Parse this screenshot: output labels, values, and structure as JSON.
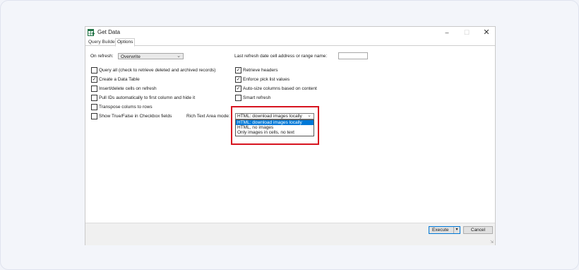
{
  "window": {
    "title": "Get Data"
  },
  "tabs": [
    {
      "label": "Query Builder"
    },
    {
      "label": "Options"
    }
  ],
  "on_refresh": {
    "label": "On refresh:",
    "value": "Overwrite"
  },
  "last_refresh": {
    "label": "Last refresh date cell address or range name:",
    "value": ""
  },
  "left_options": [
    {
      "label": "Query all (check to retrieve deleted and archived records)",
      "checked": false
    },
    {
      "label": "Create a Data Table",
      "checked": true
    },
    {
      "label": "Insert/delete cells on refresh",
      "checked": false
    },
    {
      "label": "Pull IDs automatically to first column and hide it",
      "checked": false
    },
    {
      "label": "Transpose colums to rows",
      "checked": false
    },
    {
      "label": "Show True/False in Checkbox fields",
      "checked": false
    }
  ],
  "right_options": [
    {
      "label": "Retrieve headers",
      "checked": true
    },
    {
      "label": "Enforce pick list values",
      "checked": true
    },
    {
      "label": "Auto-size columns based on content",
      "checked": true
    },
    {
      "label": "Smart refresh",
      "checked": false
    }
  ],
  "rich_text": {
    "label": "Rich Text Area mode:",
    "value": "HTML: download images locally",
    "options": [
      {
        "label": "HTML: download images locally",
        "selected": true
      },
      {
        "label": "HTML, no images",
        "selected": false
      },
      {
        "label": "Only images in cells, no text",
        "selected": false
      }
    ]
  },
  "footer": {
    "execute_label": "Execute",
    "cancel_label": "Cancel"
  },
  "colors": {
    "highlight": "#d7141f",
    "selection": "#0078d7"
  }
}
